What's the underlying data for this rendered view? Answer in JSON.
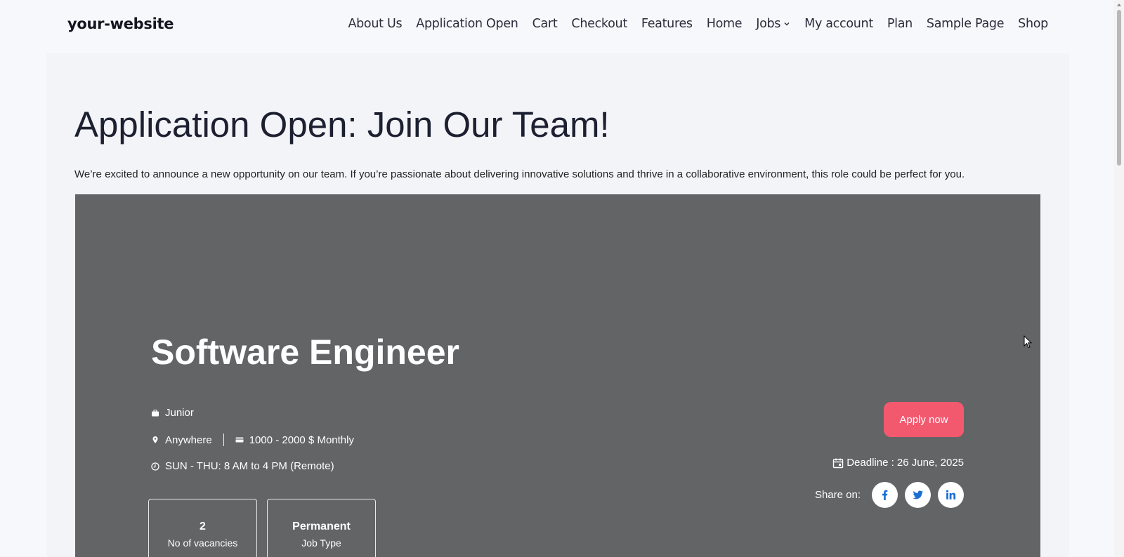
{
  "header": {
    "logo": "your-website",
    "nav": [
      {
        "label": "About Us"
      },
      {
        "label": "Application Open"
      },
      {
        "label": "Cart"
      },
      {
        "label": "Checkout"
      },
      {
        "label": "Features"
      },
      {
        "label": "Home"
      },
      {
        "label": "Jobs",
        "has_dropdown": true
      },
      {
        "label": "My account"
      },
      {
        "label": "Plan"
      },
      {
        "label": "Sample Page"
      },
      {
        "label": "Shop"
      }
    ]
  },
  "page": {
    "title": "Application Open: Join Our Team!",
    "intro": "We’re excited to announce a new opportunity on our team. If you’re passionate about delivering innovative solutions and thrive in a collaborative environment, this role could be perfect for you."
  },
  "job": {
    "title": "Software Engineer",
    "level": "Junior",
    "location": "Anywhere",
    "salary": "1000 - 2000 $ Monthly",
    "schedule": "SUN - THU: 8 AM to 4 PM (Remote)",
    "vacancies_value": "2",
    "vacancies_label": "No of vacancies",
    "job_type_value": "Permanent",
    "job_type_label": "Job Type",
    "apply_label": "Apply now",
    "deadline": "Deadline : 26 June, 2025",
    "share_label": "Share on:"
  },
  "icons": {
    "level": "briefcase-icon",
    "location": "map-pin-icon",
    "salary": "credit-card-icon",
    "schedule": "clock-icon",
    "deadline": "calendar-icon",
    "social": [
      "facebook-icon",
      "twitter-icon",
      "linkedin-icon"
    ]
  },
  "colors": {
    "hero_bg": "#636466",
    "apply_button": "#f2596f",
    "social_icon": "#1b6fd1",
    "page_bg": "#f7f8fc"
  }
}
